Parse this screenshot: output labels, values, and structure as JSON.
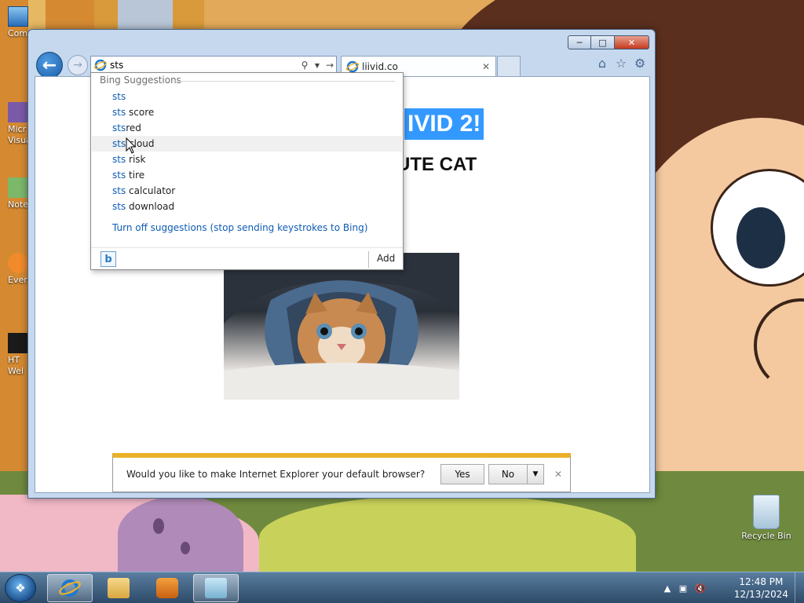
{
  "desktop": {
    "icons": [
      {
        "label": "Com"
      },
      {
        "label": "Micr"
      },
      {
        "label": "Visua"
      },
      {
        "label": "Note"
      },
      {
        "label": "Every"
      },
      {
        "label": "HT"
      },
      {
        "label": "Wel"
      }
    ],
    "recycle_bin": "Recycle Bin"
  },
  "browser": {
    "address_value": "sts",
    "tab_title": "liivid.co",
    "page": {
      "heading": "IVID 2!",
      "subheading": "UTE CAT"
    },
    "suggestions": {
      "header": "Bing Suggestions",
      "query": "sts",
      "items": [
        {
          "prefix": "sts",
          "rest": ""
        },
        {
          "prefix": "sts",
          "rest": " score"
        },
        {
          "prefix": "sts",
          "rest": "red"
        },
        {
          "prefix": "sts",
          "rest": " cloud"
        },
        {
          "prefix": "sts",
          "rest": " risk"
        },
        {
          "prefix": "sts",
          "rest": " tire"
        },
        {
          "prefix": "sts",
          "rest": " calculator"
        },
        {
          "prefix": "sts",
          "rest": " download"
        }
      ],
      "turn_off": "Turn off suggestions (stop sending keystrokes to Bing)",
      "add_label": "Add",
      "bing_logo": "b"
    },
    "notification": {
      "text": "Would you like to make Internet Explorer your default browser?",
      "yes": "Yes",
      "no": "No"
    }
  },
  "taskbar": {
    "time": "12:48 PM",
    "date": "12/13/2024"
  },
  "colors": {
    "accent_blue": "#3399ff",
    "link_blue": "#0f5cb4",
    "notif_bar": "#eab128"
  }
}
